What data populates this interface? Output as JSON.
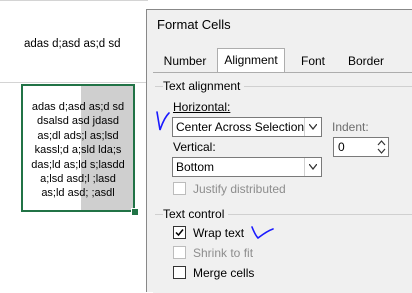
{
  "sheet": {
    "cell_a_text": "adas d;asd as;d sd",
    "wrapped_lines": [
      "adas d;asd as;d sd",
      "dsalsd asd jdasd",
      "as;dl ads;l as;lsd",
      "kassl;d a;sld lda;s",
      "das;ld as;ld s;lasdd",
      "a;lsd asd;l ;lasd",
      "as;ld asd; ;asdl"
    ]
  },
  "dialog": {
    "title": "Format Cells",
    "tabs": [
      "Number",
      "Alignment",
      "Font",
      "Border"
    ],
    "active_tab": "Alignment",
    "text_alignment_label": "Text alignment",
    "horizontal_label": "Horizontal:",
    "horizontal_value": "Center Across Selection",
    "indent_label": "Indent:",
    "indent_value": "0",
    "vertical_label": "Vertical:",
    "vertical_value": "Bottom",
    "justify_distributed_label": "Justify distributed",
    "text_control_label": "Text control",
    "wrap_text_label": "Wrap text",
    "wrap_text_checked": true,
    "shrink_to_fit_label": "Shrink to fit",
    "merge_cells_label": "Merge cells"
  },
  "colors": {
    "selection_border": "#217346",
    "annotation_ink": "#1a1aff"
  }
}
